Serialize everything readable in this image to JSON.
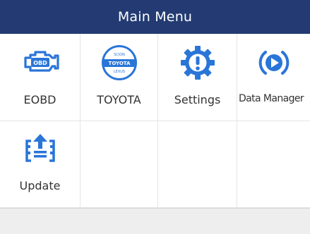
{
  "header": {
    "title": "Main Menu"
  },
  "colors": {
    "title_bar": "#233b72",
    "icon_blue": "#2a75d8",
    "label": "#333333",
    "status_bar": "#eeeeee"
  },
  "menu": {
    "items": [
      {
        "label": "EOBD",
        "icon": "engine-obd-icon"
      },
      {
        "label": "TOYOTA",
        "icon": "toyota-badge-icon",
        "badge_text": [
          "SCION",
          "TOYOTA",
          "LEXUS"
        ]
      },
      {
        "label": "Settings",
        "icon": "gear-alert-icon"
      },
      {
        "label": "Data Manager",
        "icon": "play-record-icon"
      },
      {
        "label": "Update",
        "icon": "upload-arrow-icon"
      }
    ]
  }
}
